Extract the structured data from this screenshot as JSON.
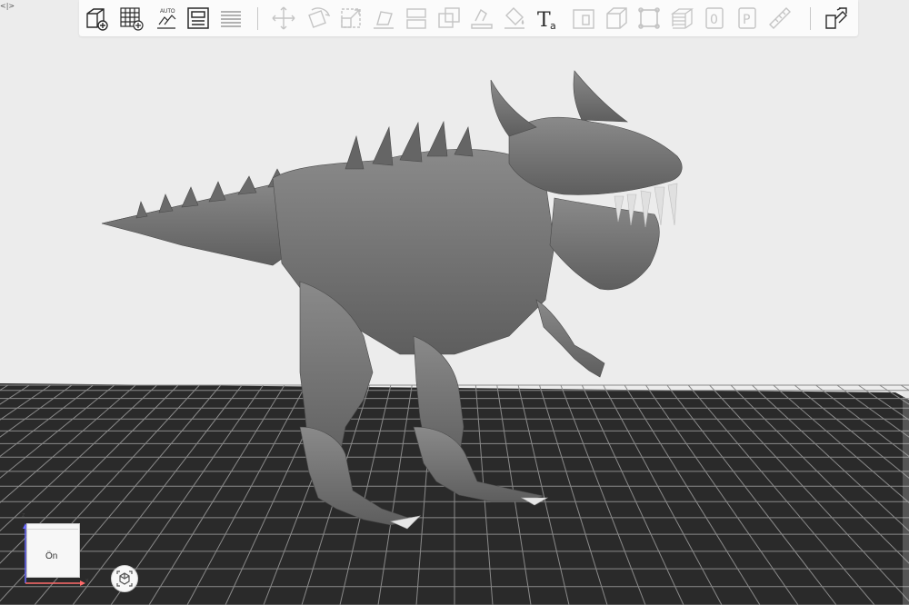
{
  "toolbar": {
    "items": [
      {
        "name": "add-object",
        "icon": "cube-plus-icon"
      },
      {
        "name": "add-plate",
        "icon": "grid-plus-icon"
      },
      {
        "name": "auto-arrange",
        "icon": "auto-arrange-icon",
        "label": "AUTO"
      },
      {
        "name": "layout",
        "icon": "layout-icon"
      },
      {
        "name": "list",
        "icon": "list-lines-icon"
      },
      {
        "name": "move",
        "icon": "move-arrows-icon"
      },
      {
        "name": "rotate",
        "icon": "rotate-icon"
      },
      {
        "name": "scale",
        "icon": "scale-icon"
      },
      {
        "name": "place-on-face",
        "icon": "place-face-icon"
      },
      {
        "name": "cut",
        "icon": "cut-icon"
      },
      {
        "name": "boolean",
        "icon": "boolean-icon"
      },
      {
        "name": "supports",
        "icon": "support-paint-icon"
      },
      {
        "name": "seam-paint",
        "icon": "paint-bucket-icon"
      },
      {
        "name": "text",
        "icon": "text-icon",
        "label": "T",
        "sublabel": "a"
      },
      {
        "name": "emboss",
        "icon": "emboss-icon"
      },
      {
        "name": "box",
        "icon": "box-icon"
      },
      {
        "name": "fit",
        "icon": "fit-corners-icon"
      },
      {
        "name": "layers",
        "icon": "layers-icon"
      },
      {
        "name": "variable-layer",
        "icon": "zero-icon",
        "label": "0"
      },
      {
        "name": "plate-p",
        "icon": "p-icon",
        "label": "P"
      },
      {
        "name": "measure",
        "icon": "ruler-icon"
      },
      {
        "name": "assembly",
        "icon": "assembly-icon"
      }
    ]
  },
  "sidebar_toggle": "<|>",
  "view_cube": {
    "face_label": "Ön",
    "axes": {
      "z": "z",
      "x": "x"
    }
  },
  "colors": {
    "model": "#757575",
    "plate": "#2b2b2b",
    "grid": "#8a8a8a",
    "background": "#ececec"
  }
}
